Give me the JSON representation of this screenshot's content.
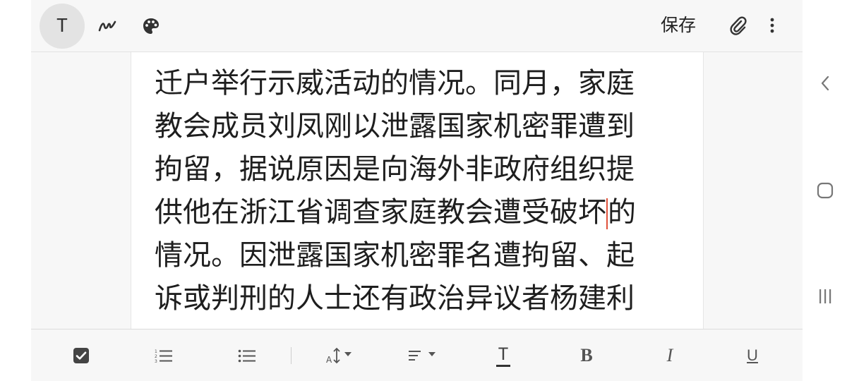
{
  "toolbar": {
    "text_tool_glyph": "T",
    "save_label": "保存"
  },
  "document": {
    "lines": [
      "迁户举行示威活动的情况。同月，家庭",
      "教会成员刘凤刚以泄露国家机密罪遭到",
      "拘留，据说原因是向海外非政府组织提",
      "情况。因泄露国家机密罪名遭拘留、起",
      "诉或判刑的人士还有政治异议者杨建利"
    ],
    "cursor_line": {
      "before_cursor": "供他在浙江省调查家庭教会遭受破坏",
      "after_cursor": "的"
    }
  },
  "format_bar": {
    "bold_glyph": "B",
    "italic_glyph": "I",
    "underline_glyph": "U",
    "text_style_glyph": "T"
  },
  "icons": {
    "top": [
      "text-mode-icon",
      "pen-icon",
      "palette-icon",
      "paperclip-icon",
      "more-vertical-icon"
    ],
    "bottom": [
      "checkbox-icon",
      "numbered-list-icon",
      "bullet-list-icon",
      "font-size-icon",
      "align-icon",
      "text-style-icon",
      "bold-icon",
      "italic-icon",
      "underline-icon"
    ],
    "nav": [
      "back-icon",
      "home-icon",
      "recents-icon"
    ]
  },
  "colors": {
    "cursor": "#e0503a",
    "active_tool_bg": "#e3e3e3",
    "toolbar_bg": "#f7f7f7"
  }
}
